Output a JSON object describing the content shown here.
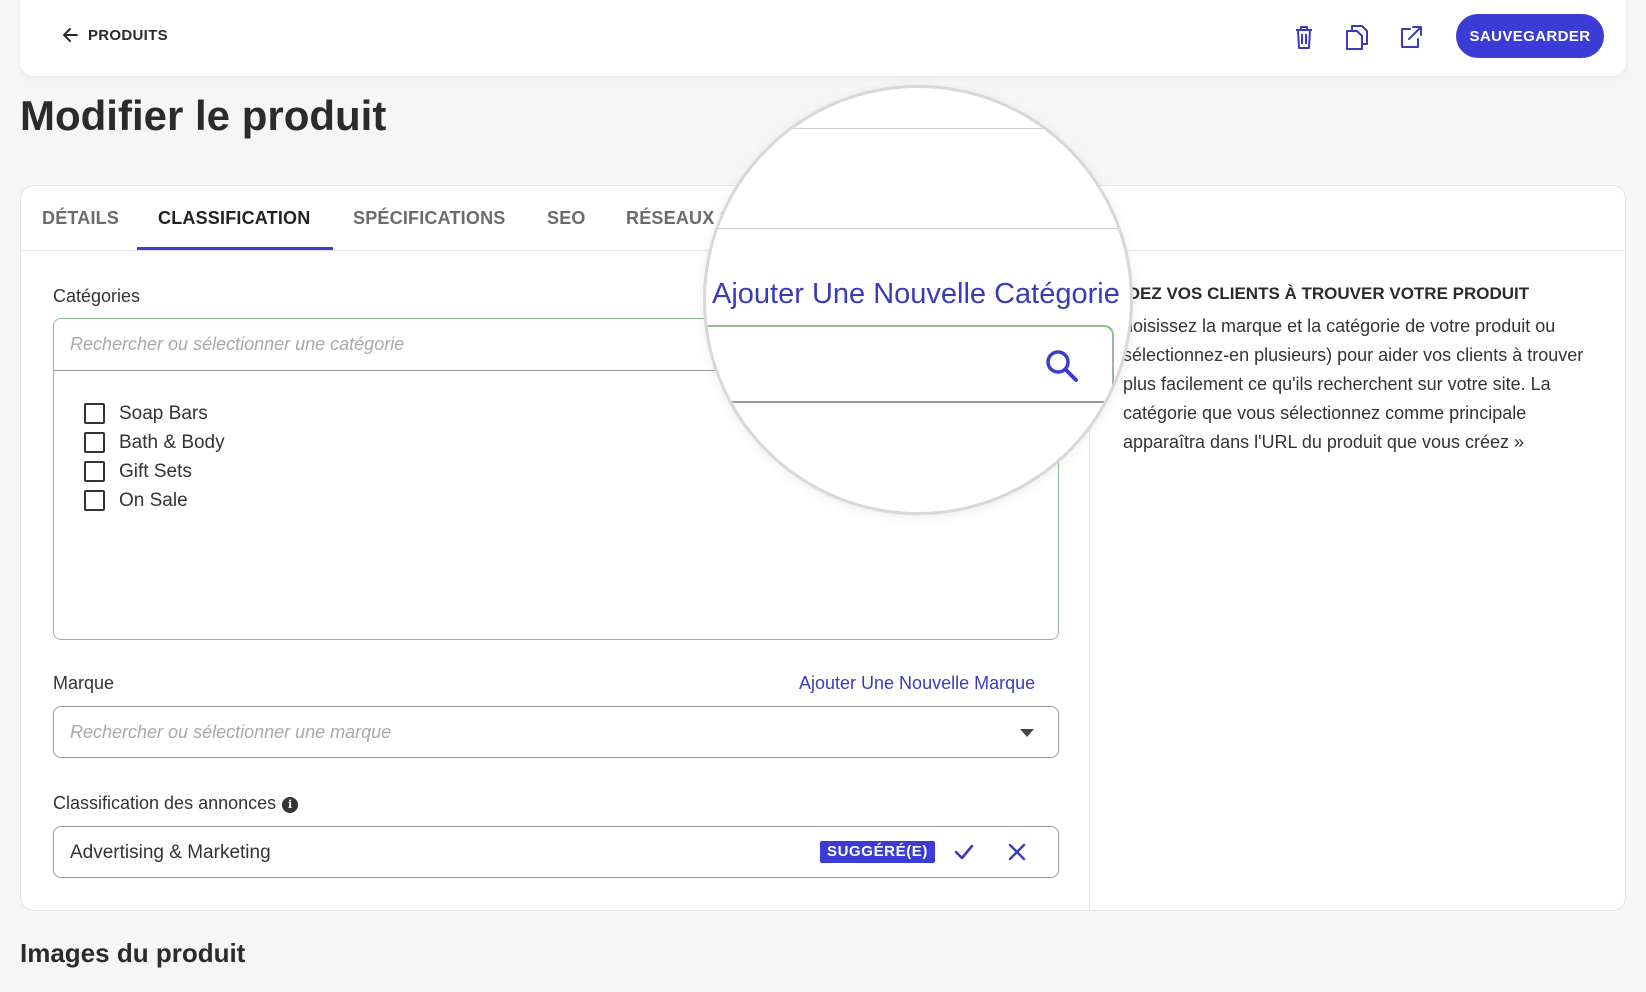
{
  "topbar": {
    "back_label": "PRODUITS",
    "icons": [
      "trash-icon",
      "duplicate-icon",
      "external-link-icon"
    ],
    "save_label": "SAUVEGARDER"
  },
  "page_title": "Modifier le produit",
  "tabs": [
    {
      "label": "DÉTAILS",
      "active": false
    },
    {
      "label": "CLASSIFICATION",
      "active": true
    },
    {
      "label": "SPÉCIFICATIONS",
      "active": false
    },
    {
      "label": "SEO",
      "active": false
    },
    {
      "label": "RÉSEAUX S",
      "active": false
    }
  ],
  "categories": {
    "label": "Catégories",
    "add_link": "Ajouter Une Nouvelle Catégorie",
    "search_placeholder": "Rechercher ou sélectionner une catégorie",
    "items": [
      {
        "label": "Soap Bars",
        "checked": false
      },
      {
        "label": "Bath & Body",
        "checked": false
      },
      {
        "label": "Gift Sets",
        "checked": false
      },
      {
        "label": "On Sale",
        "checked": false
      }
    ]
  },
  "brand": {
    "label": "Marque",
    "add_link": "Ajouter Une Nouvelle Marque",
    "placeholder": "Rechercher ou sélectionner une marque"
  },
  "ad_classification": {
    "label": "Classification des annonces",
    "value": "Advertising & Marketing",
    "badge": "SUGGÉRÉ(E)"
  },
  "help": {
    "title": "IDEZ VOS CLIENTS À TROUVER VOTRE PRODUIT",
    "text": "hoisissez la marque et la catégorie de votre produit ou sélectionnez-en plusieurs) pour aider vos clients à trouver plus facilement ce qu'ils recherchent sur votre site. La catégorie que vous sélectionnez comme principale apparaîtra dans l'URL du produit que vous créez »"
  },
  "images_section_title": "Images du produit",
  "colors": {
    "accent": "#3b3bd6",
    "link": "#3b3bb8",
    "focus_border": "#8cbf8c"
  }
}
